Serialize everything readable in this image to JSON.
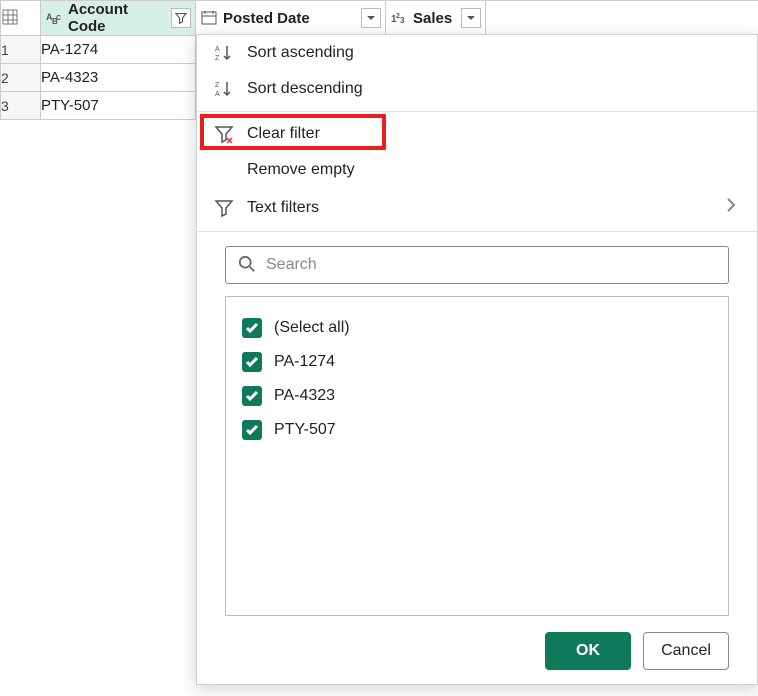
{
  "columns": {
    "account": {
      "label": "Account Code"
    },
    "posted": {
      "label": "Posted Date"
    },
    "sales": {
      "label": "Sales"
    }
  },
  "rows": [
    {
      "n": "1",
      "account": "PA-1274"
    },
    {
      "n": "2",
      "account": "PA-4323"
    },
    {
      "n": "3",
      "account": "PTY-507"
    }
  ],
  "menu": {
    "sort_asc": "Sort ascending",
    "sort_desc": "Sort descending",
    "clear_filter": "Clear filter",
    "remove_empty": "Remove empty",
    "text_filters": "Text filters"
  },
  "search": {
    "placeholder": "Search"
  },
  "filter_items": [
    {
      "label": "(Select all)"
    },
    {
      "label": "PA-1274"
    },
    {
      "label": "PA-4323"
    },
    {
      "label": "PTY-507"
    }
  ],
  "buttons": {
    "ok": "OK",
    "cancel": "Cancel"
  }
}
